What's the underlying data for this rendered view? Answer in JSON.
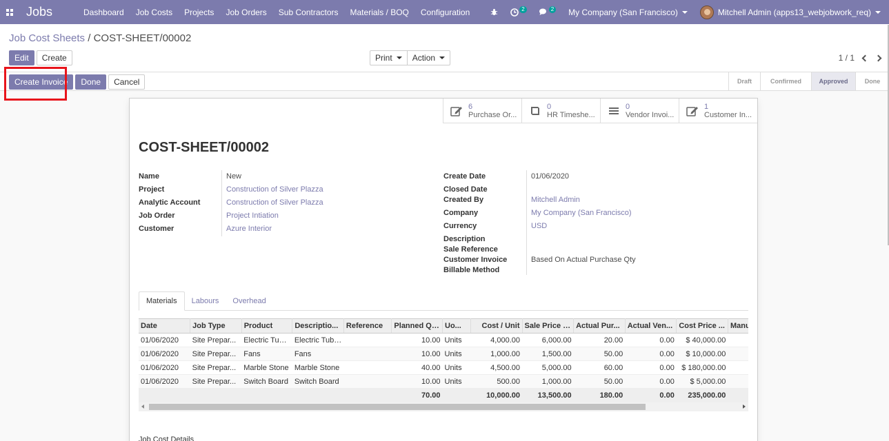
{
  "topbar": {
    "brand": "Jobs",
    "menu": [
      "Dashboard",
      "Job Costs",
      "Projects",
      "Job Orders",
      "Sub Contractors",
      "Materials / BOQ",
      "Configuration"
    ],
    "activity_count": "2",
    "message_count": "2",
    "company": "My Company (San Francisco)",
    "user": "Mitchell Admin (apps13_webjobwork_req)"
  },
  "breadcrumb": {
    "parent": "Job Cost Sheets",
    "separator": "/",
    "current": "COST-SHEET/00002"
  },
  "buttons": {
    "edit": "Edit",
    "create": "Create",
    "print": "Print",
    "action": "Action",
    "create_invoice": "Create Invoice",
    "done": "Done",
    "cancel": "Cancel"
  },
  "pager": "1 / 1",
  "stages": [
    {
      "label": "Draft",
      "active": false
    },
    {
      "label": "Confirmed",
      "active": false
    },
    {
      "label": "Approved",
      "active": true
    },
    {
      "label": "Done",
      "active": false
    }
  ],
  "smart_buttons": [
    {
      "count": "6",
      "label": "Purchase Or...",
      "icon": "edit-icon"
    },
    {
      "count": "0",
      "label": "HR Timeshe...",
      "icon": "book-icon"
    },
    {
      "count": "0",
      "label": "Vendor Invoi...",
      "icon": "list-icon"
    },
    {
      "count": "1",
      "label": "Customer In...",
      "icon": "edit-icon"
    }
  ],
  "record_title": "COST-SHEET/00002",
  "left_fields": [
    {
      "label": "Name",
      "value": "New",
      "link": false
    },
    {
      "label": "Project",
      "value": "Construction of Silver Plazza",
      "link": true
    },
    {
      "label": "Analytic Account",
      "value": "Construction of Silver Plazza",
      "link": true
    },
    {
      "label": "Job Order",
      "value": "Project Intiation",
      "link": true
    },
    {
      "label": "Customer",
      "value": "Azure Interior",
      "link": true
    }
  ],
  "right_fields": {
    "create_date_label": "Create Date",
    "create_date": "01/06/2020",
    "closed_date_label": "Closed Date",
    "created_by_label": "Created By",
    "created_by": "Mitchell Admin",
    "company_label": "Company",
    "company": "My Company (San Francisco)",
    "currency_label": "Currency",
    "currency": "USD",
    "description_label": "Description",
    "sale_reference_label": "Sale Reference",
    "customer_invoice_label": "Customer Invoice",
    "customer_invoice": "Based On Actual Purchase Qty",
    "billable_method_label": "Billable Method"
  },
  "tabs": [
    "Materials",
    "Labours",
    "Overhead"
  ],
  "table": {
    "headers": [
      "Date",
      "Job Type",
      "Product",
      "Descriptio...",
      "Reference",
      "Planned Qt...",
      "Uo...",
      "Cost / Unit",
      "Sale Price /...",
      "Actual Pur...",
      "Actual Ven...",
      "Cost Price ...",
      "Manual In"
    ],
    "rows": [
      [
        "01/06/2020",
        "Site Prepar...",
        "Electric Tubes",
        "Electric Tubes",
        "",
        "10.00",
        "Units",
        "4,000.00",
        "6,000.00",
        "20.00",
        "0.00",
        "$ 40,000.00",
        ""
      ],
      [
        "01/06/2020",
        "Site Prepar...",
        "Fans",
        "Fans",
        "",
        "10.00",
        "Units",
        "1,000.00",
        "1,500.00",
        "50.00",
        "0.00",
        "$ 10,000.00",
        ""
      ],
      [
        "01/06/2020",
        "Site Prepar...",
        "Marble Stone",
        "Marble Stone",
        "",
        "40.00",
        "Units",
        "4,500.00",
        "5,000.00",
        "60.00",
        "0.00",
        "$ 180,000.00",
        ""
      ],
      [
        "01/06/2020",
        "Site Prepar...",
        "Switch Board",
        "Switch Board",
        "",
        "10.00",
        "Units",
        "500.00",
        "1,000.00",
        "50.00",
        "0.00",
        "$ 5,000.00",
        ""
      ]
    ],
    "totals": [
      "",
      "",
      "",
      "",
      "",
      "70.00",
      "",
      "10,000.00",
      "13,500.00",
      "180.00",
      "0.00",
      "235,000.00",
      ""
    ]
  },
  "section_label": "Job Cost Details",
  "colors": {
    "primary": "#7c7bad",
    "highlight": "#e8141b"
  }
}
